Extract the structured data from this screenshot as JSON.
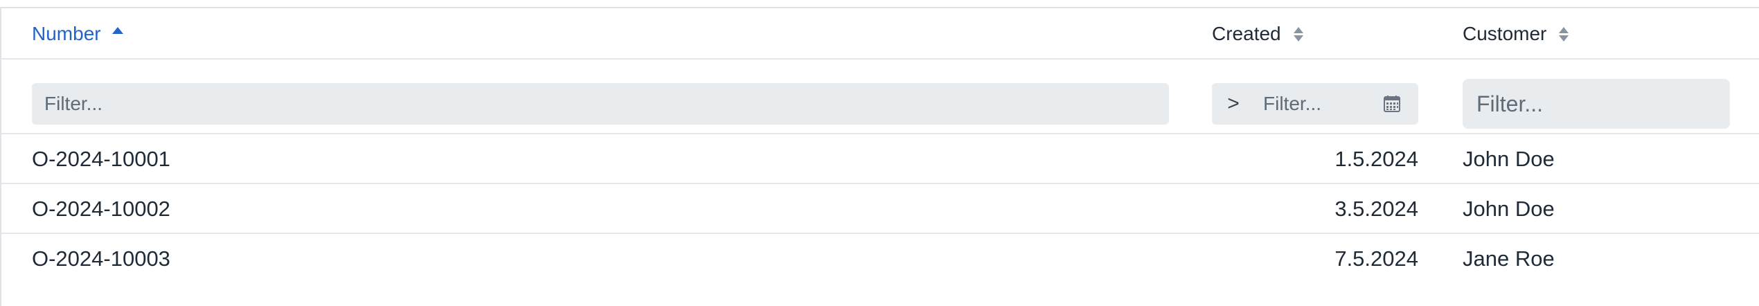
{
  "columns": {
    "number": {
      "label": "Number",
      "sort": "ascending",
      "filter_placeholder": "Filter..."
    },
    "created": {
      "label": "Created",
      "sort": "none",
      "filter_operator": ">",
      "filter_placeholder": "Filter..."
    },
    "customer": {
      "label": "Customer",
      "sort": "none",
      "filter_placeholder": "Filter..."
    }
  },
  "rows": [
    {
      "number": "O-2024-10001",
      "created": "1.5.2024",
      "customer": "John Doe"
    },
    {
      "number": "O-2024-10002",
      "created": "3.5.2024",
      "customer": "John Doe"
    },
    {
      "number": "O-2024-10003",
      "created": "7.5.2024",
      "customer": "Jane Roe"
    }
  ],
  "icons": {
    "sort_active": "sort-ascending-icon",
    "sort_inactive": "sort-icon",
    "date_picker": "calendar-icon"
  },
  "colors": {
    "accent": "#2364c8",
    "text": "#1f2a37",
    "filter_bg": "#e9ecef",
    "border": "#dfe2e7"
  }
}
